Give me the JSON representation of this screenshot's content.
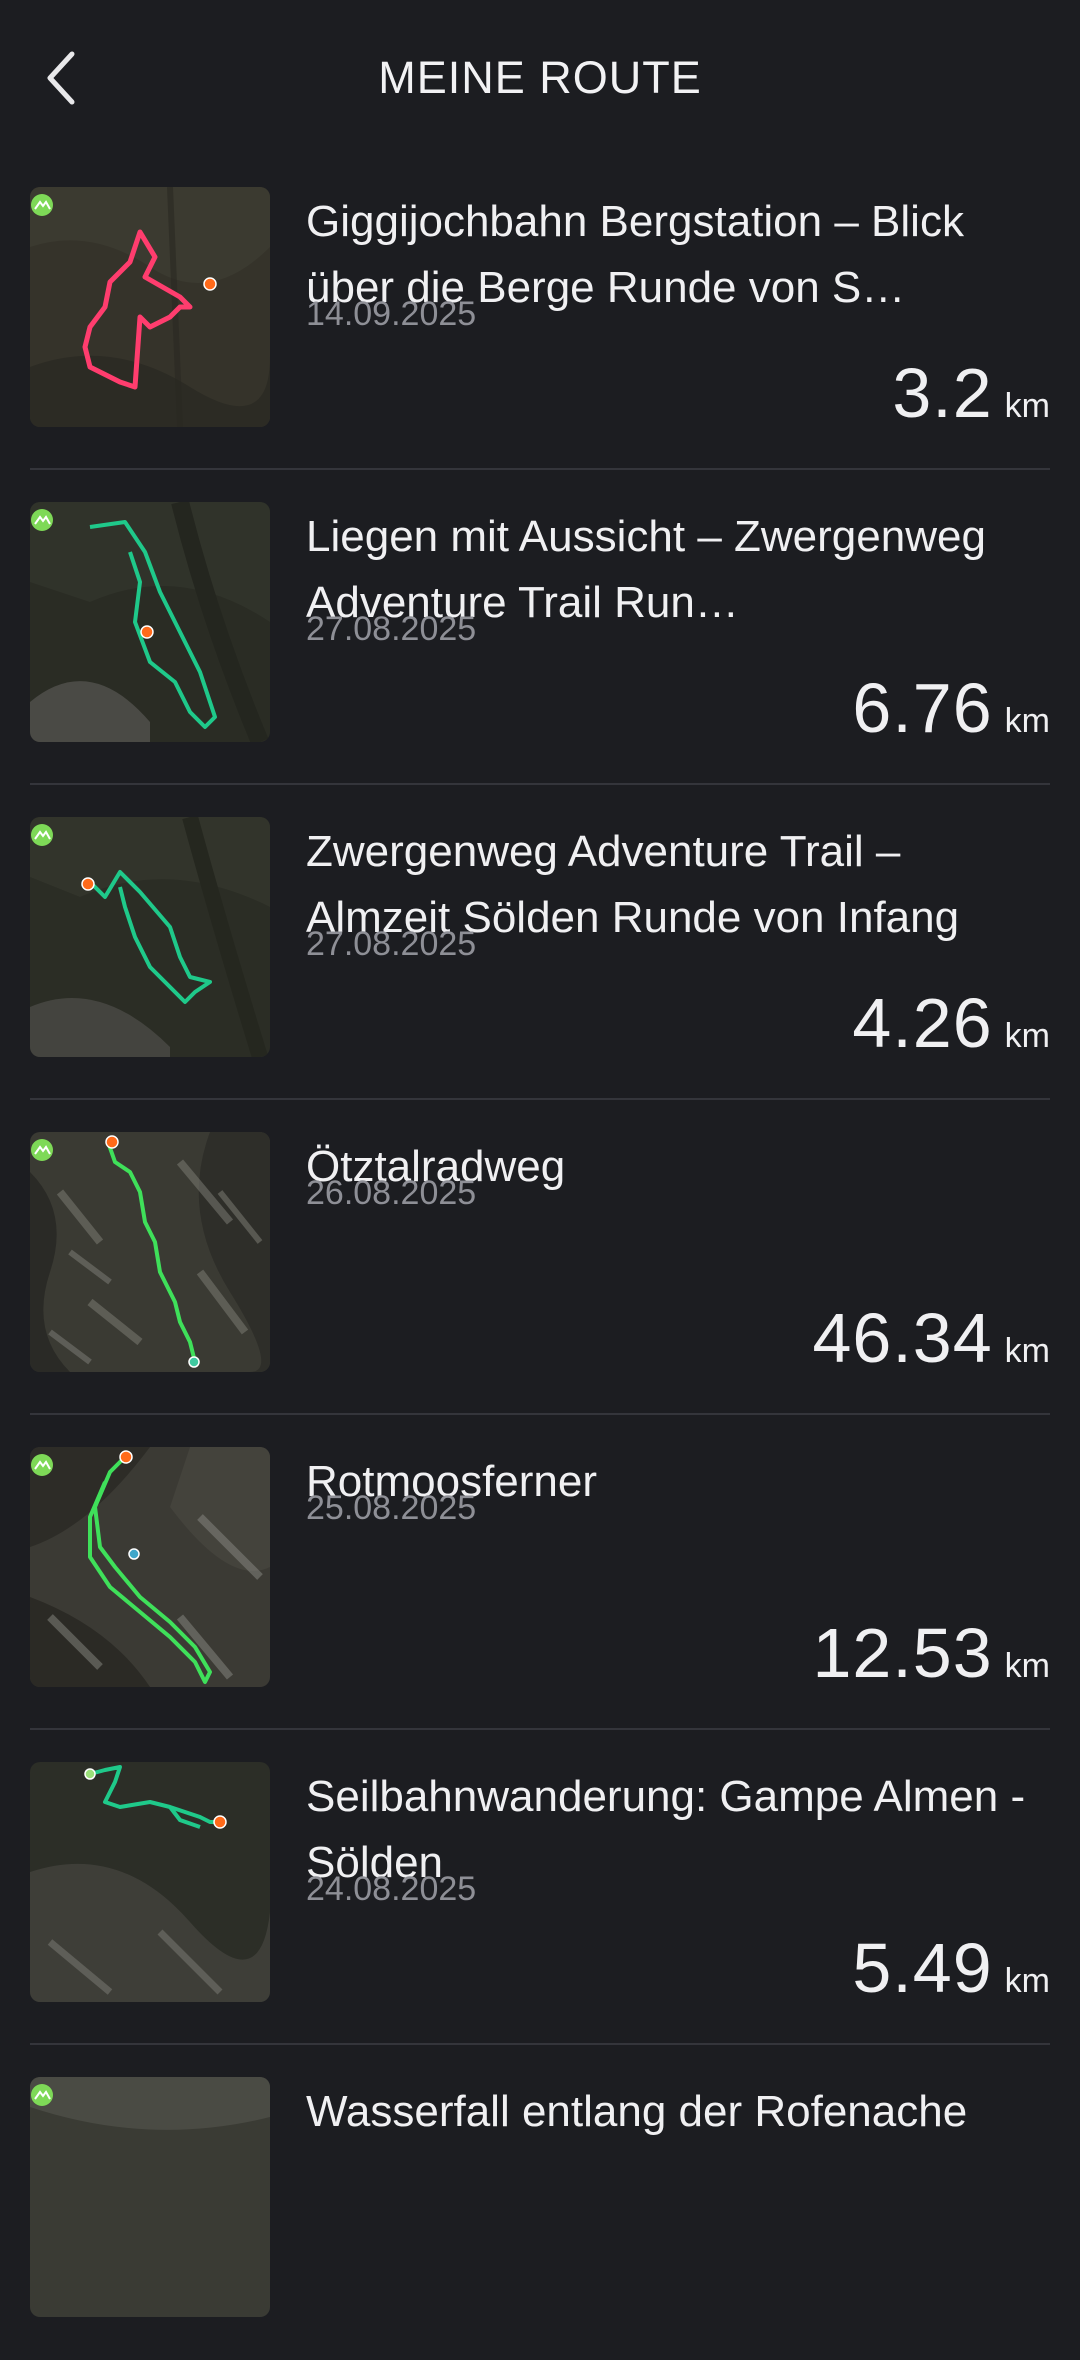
{
  "header": {
    "title": "MEINE ROUTE",
    "back_icon": "chevron-left-icon"
  },
  "routes": [
    {
      "title": "Giggijochbahn Bergstation – Blick über die Berge Runde von S…",
      "date": "14.09.2025",
      "distance": "3.2",
      "unit": "km",
      "track_color": "#ff3d6e"
    },
    {
      "title": "Liegen mit Aussicht – Zwergenweg Adventure Trail Run…",
      "date": "27.08.2025",
      "distance": "6.76",
      "unit": "km",
      "track_color": "#1fc98a"
    },
    {
      "title": "Zwergenweg Adventure Trail – Almzeit Sölden Runde von Infang",
      "date": "27.08.2025",
      "distance": "4.26",
      "unit": "km",
      "track_color": "#1fc98a"
    },
    {
      "title": "Ötztalradweg",
      "date": "26.08.2025",
      "distance": "46.34",
      "unit": "km",
      "track_color": "#3fe05a"
    },
    {
      "title": "Rotmoosferner",
      "date": "25.08.2025",
      "distance": "12.53",
      "unit": "km",
      "track_color": "#3fe05a"
    },
    {
      "title": "Seilbahnwanderung: Gampe Almen - Sölden",
      "date": "24.08.2025",
      "distance": "5.49",
      "unit": "km",
      "track_color": "#1fc98a"
    },
    {
      "title": "Wasserfall entlang der Rofenache",
      "date": "",
      "distance": "",
      "unit": "",
      "track_color": "#1fc98a"
    }
  ],
  "colors": {
    "background": "#1c1d21",
    "divider": "#34353b",
    "date_text": "#8e8f96",
    "start_marker": "#ff6a1a",
    "badge": "#7ed957"
  }
}
